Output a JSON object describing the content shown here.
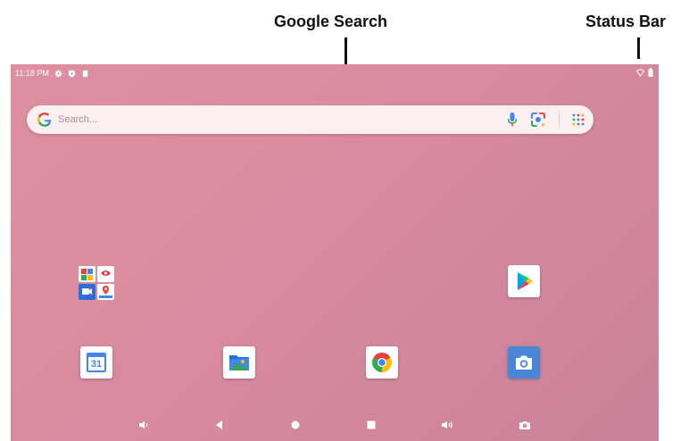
{
  "annotations": {
    "google_search": "Google Search",
    "status_bar": "Status Bar"
  },
  "status_bar": {
    "time": "11:18 PM",
    "left_icons": [
      "gear-icon",
      "shield-icon",
      "sd-card-icon"
    ],
    "right_icons": [
      "wifi-icon",
      "battery-icon"
    ]
  },
  "search": {
    "placeholder": "Search...",
    "icons": [
      "google-g-icon",
      "microphone-icon",
      "lens-icon",
      "apps-grid-icon"
    ]
  },
  "home_apps": [
    "google-apps-folder",
    "play-store",
    "calendar",
    "files",
    "chrome",
    "camera"
  ],
  "calendar_day": "31",
  "navigation": [
    "volume-down-icon",
    "back-icon",
    "home-icon",
    "recents-icon",
    "volume-up-icon",
    "screenshot-icon"
  ],
  "colors": {
    "wallpaper": "#d88aa0",
    "search_bg": "#fbeff2"
  }
}
